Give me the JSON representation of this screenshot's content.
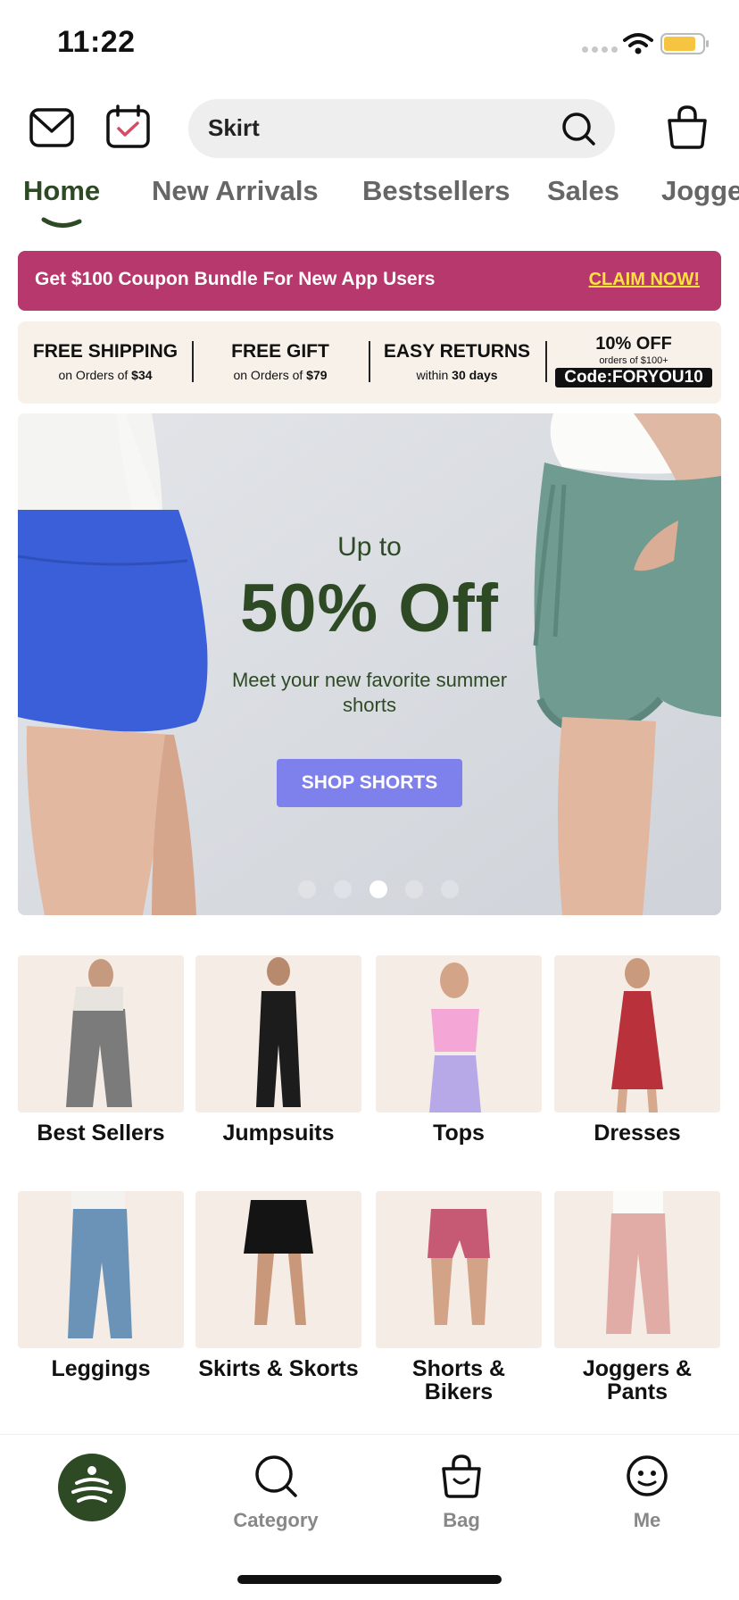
{
  "status_bar": {
    "time": "11:22"
  },
  "header": {
    "search": {
      "value": "Skirt",
      "placeholder": "Skirt"
    },
    "icons": [
      "mail-icon",
      "calendar-check-icon",
      "search-icon",
      "bag-icon"
    ]
  },
  "tabs": [
    {
      "label": "Home",
      "active": true
    },
    {
      "label": "New Arrivals",
      "active": false
    },
    {
      "label": "Bestsellers",
      "active": false
    },
    {
      "label": "Sales",
      "active": false
    },
    {
      "label": "Jogge",
      "active": false
    }
  ],
  "promo": {
    "text": "Get $100 Coupon Bundle For New App Users",
    "cta": "CLAIM NOW!",
    "color": "#b7386c",
    "cta_color": "#ffe23d"
  },
  "benefits": [
    {
      "title": "FREE SHIPPING",
      "sub_prefix": "on Orders of ",
      "sub_bold": "$34"
    },
    {
      "title": "FREE GIFT",
      "sub_prefix": "on Orders of ",
      "sub_bold": "$79"
    },
    {
      "title": "EASY RETURNS",
      "sub_prefix": "within ",
      "sub_bold": "30 days"
    },
    {
      "title": "10% OFF",
      "sub": "orders of $100+",
      "code_label": "Code:",
      "code": "FORYOU10"
    }
  ],
  "hero": {
    "pre": "Up to",
    "headline": "50% Off",
    "sub": "Meet your new favorite summer shorts",
    "button": "SHOP SHORTS",
    "active_slide": 3,
    "slides": 5,
    "accent": "#2d4a25",
    "button_color": "#7e80ec"
  },
  "categories": [
    {
      "label": "Best Sellers"
    },
    {
      "label": "Jumpsuits"
    },
    {
      "label": "Tops"
    },
    {
      "label": "Dresses"
    },
    {
      "label": "Leggings"
    },
    {
      "label": "Skirts & Skorts"
    },
    {
      "label": "Shorts & Bikers"
    },
    {
      "label": "Joggers & Pants"
    }
  ],
  "bottom_nav": [
    {
      "label": "",
      "icon": "home-logo-icon",
      "active": true
    },
    {
      "label": "Category",
      "icon": "search-icon"
    },
    {
      "label": "Bag",
      "icon": "bag-smile-icon"
    },
    {
      "label": "Me",
      "icon": "smile-icon"
    }
  ]
}
